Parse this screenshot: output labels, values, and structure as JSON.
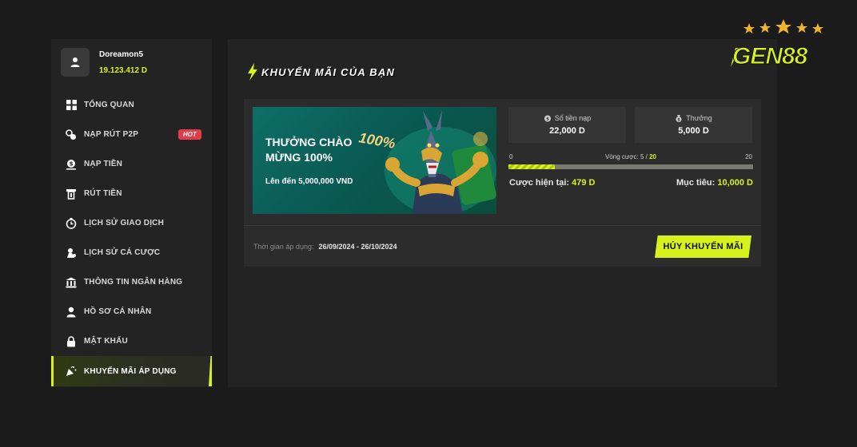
{
  "user": {
    "name": "Doreamon5",
    "balance": "19.123.412 D"
  },
  "sidebar": {
    "items": [
      {
        "label": "TỔNG QUAN",
        "icon": "grid-icon",
        "name": "sidebar-item-overview"
      },
      {
        "label": "NẠP RÚT P2P",
        "icon": "p2p-coins-icon",
        "name": "sidebar-item-p2p",
        "badge": "HOT"
      },
      {
        "label": "NẠP TIỀN",
        "icon": "deposit-icon",
        "name": "sidebar-item-deposit"
      },
      {
        "label": "RÚT TIỀN",
        "icon": "withdraw-icon",
        "name": "sidebar-item-withdraw"
      },
      {
        "label": "LỊCH SỬ GIAO DỊCH",
        "icon": "history-clock-icon",
        "name": "sidebar-item-transaction-history"
      },
      {
        "label": "LỊCH SỬ CÁ CƯỢC",
        "icon": "bet-history-icon",
        "name": "sidebar-item-bet-history"
      },
      {
        "label": "THÔNG TIN NGÂN HÀNG",
        "icon": "bank-icon",
        "name": "sidebar-item-bank-info"
      },
      {
        "label": "HỒ SƠ CÁ NHÂN",
        "icon": "person-icon",
        "name": "sidebar-item-profile"
      },
      {
        "label": "MẬT KHẨU",
        "icon": "lock-icon",
        "name": "sidebar-item-password"
      },
      {
        "label": "KHUYẾN MÃI ÁP DỤNG",
        "icon": "party-popper-icon",
        "name": "sidebar-item-promotions",
        "active": true
      }
    ]
  },
  "main": {
    "title": "KHUYẾN MÃI CỦA BẠN",
    "promo": {
      "banner": {
        "line1": "THƯỞNG CHÀO",
        "line2": "MỪNG 100%",
        "subtitle": "Lên đến 5,000,000 VND",
        "badge": "100%"
      },
      "deposit": {
        "label": "Số tiền nạp",
        "value": "22,000 D"
      },
      "bonus": {
        "label": "Thưởng",
        "value": "5,000 D"
      },
      "progress": {
        "min": "0",
        "max": "20",
        "label": "Vòng cược: 5 /",
        "target": "20",
        "fraction": 0.19
      },
      "current_bet_label": "Cược hiện tại:",
      "current_bet_value": "479 D",
      "goal_label": "Mục tiêu:",
      "goal_value": "10,000 D",
      "period_label": "Thời gian áp dụng:",
      "period_value": "26/09/2024 - 26/10/2024",
      "cancel_button": "HỦY KHUYẾN MÃI"
    }
  },
  "logo": {
    "text": "GEN88"
  },
  "colors": {
    "accent": "#d7f11d",
    "hot": "#e23b4a",
    "background": "#1b1b1b",
    "panel": "#232323"
  }
}
